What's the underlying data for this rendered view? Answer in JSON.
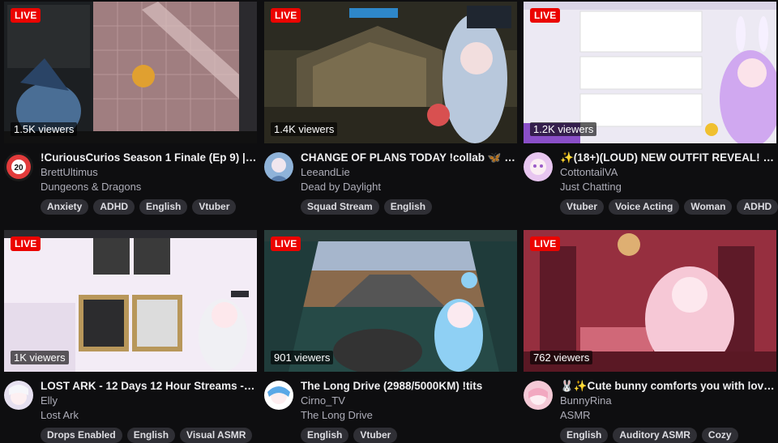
{
  "live_label": "LIVE",
  "streams": [
    {
      "viewers": "1.5K viewers",
      "title": "!CuriousCurios Season 1 Finale (Ep 9) | !p...",
      "channel": "BrettUltimus",
      "category": "Dungeons & Dragons",
      "tags": [
        "Anxiety",
        "ADHD",
        "English",
        "Vtuber"
      ],
      "thumb_colors": [
        "#7a5a62",
        "#b48a8a"
      ],
      "avatar_color": "#1b1b1b"
    },
    {
      "viewers": "1.4K viewers",
      "title": "CHANGE OF PLANS TODAY !collab 🦋 #E...",
      "channel": "LeeandLie",
      "category": "Dead by Daylight",
      "tags": [
        "Squad Stream",
        "English"
      ],
      "thumb_colors": [
        "#3d3a2c",
        "#8a7a55"
      ],
      "avatar_color": "#8fb3d9"
    },
    {
      "viewers": "1.2K viewers",
      "title": "✨(18+)(LOUD) NEW OUTFIT REVEAL! | !d...",
      "channel": "CottontailVA",
      "category": "Just Chatting",
      "tags": [
        "Vtuber",
        "Voice Acting",
        "Woman",
        "ADHD"
      ],
      "thumb_colors": [
        "#e9e6f2",
        "#c8b6e6"
      ],
      "avatar_color": "#e8c6f0"
    },
    {
      "viewers": "1K viewers",
      "title": "LOST ARK - 12 Days 12 Hour Streams - Da...",
      "channel": "Elly",
      "category": "Lost Ark",
      "tags": [
        "Drops Enabled",
        "English",
        "Visual ASMR"
      ],
      "thumb_colors": [
        "#f3eaf6",
        "#d7c4e6"
      ],
      "avatar_color": "#e6e0f0"
    },
    {
      "viewers": "901 viewers",
      "title": "The Long Drive (2988/5000KM) !tits",
      "channel": "Cirno_TV",
      "category": "The Long Drive",
      "tags": [
        "English",
        "Vtuber"
      ],
      "thumb_colors": [
        "#9fb0c6",
        "#7a5840"
      ],
      "avatar_color": "#6fb6f0"
    },
    {
      "viewers": "762 viewers",
      "title": "🐰✨Cute bunny comforts you with love! ...",
      "channel": "BunnyRina",
      "category": "ASMR",
      "tags": [
        "English",
        "Auditory ASMR",
        "Cozy"
      ],
      "thumb_colors": [
        "#8a2c3c",
        "#d46a7a"
      ],
      "avatar_color": "#f4c9d6"
    }
  ]
}
